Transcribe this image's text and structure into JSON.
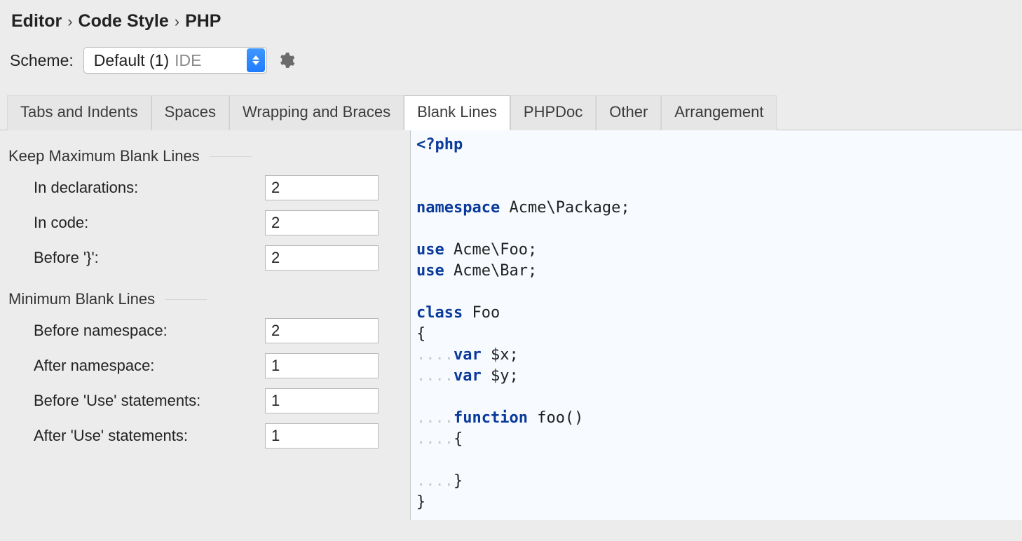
{
  "breadcrumb": {
    "a": "Editor",
    "b": "Code Style",
    "c": "PHP"
  },
  "scheme": {
    "label": "Scheme:",
    "value": "Default (1)",
    "tag": "IDE"
  },
  "tabs": {
    "t0": "Tabs and Indents",
    "t1": "Spaces",
    "t2": "Wrapping and Braces",
    "t3": "Blank Lines",
    "t4": "PHPDoc",
    "t5": "Other",
    "t6": "Arrangement"
  },
  "groups": {
    "keepMax": {
      "title": "Keep Maximum Blank Lines",
      "inDeclarations": {
        "label": "In declarations:",
        "value": "2"
      },
      "inCode": {
        "label": "In code:",
        "value": "2"
      },
      "beforeBrace": {
        "label": "Before '}':",
        "value": "2"
      }
    },
    "min": {
      "title": "Minimum Blank Lines",
      "beforeNamespace": {
        "label": "Before namespace:",
        "value": "2"
      },
      "afterNamespace": {
        "label": "After namespace:",
        "value": "1"
      },
      "beforeUse": {
        "label": "Before 'Use' statements:",
        "value": "1"
      },
      "afterUse": {
        "label": "After 'Use' statements:",
        "value": "1"
      }
    }
  },
  "code": {
    "phpOpen": "<?php",
    "nsKw": "namespace",
    "ns": " Acme\\Package;",
    "useKw": "use",
    "use1": " Acme\\Foo;",
    "use2": " Acme\\Bar;",
    "classKw": "class",
    "className": " Foo",
    "openBrace": "{",
    "varKw": "var",
    "varX": " $x;",
    "varY": " $y;",
    "fnKw": "function",
    "fnSig": " foo()",
    "fnOpen": "{",
    "fnClose": "}",
    "closeBrace": "}",
    "indent": "....",
    "indent2": "........"
  }
}
